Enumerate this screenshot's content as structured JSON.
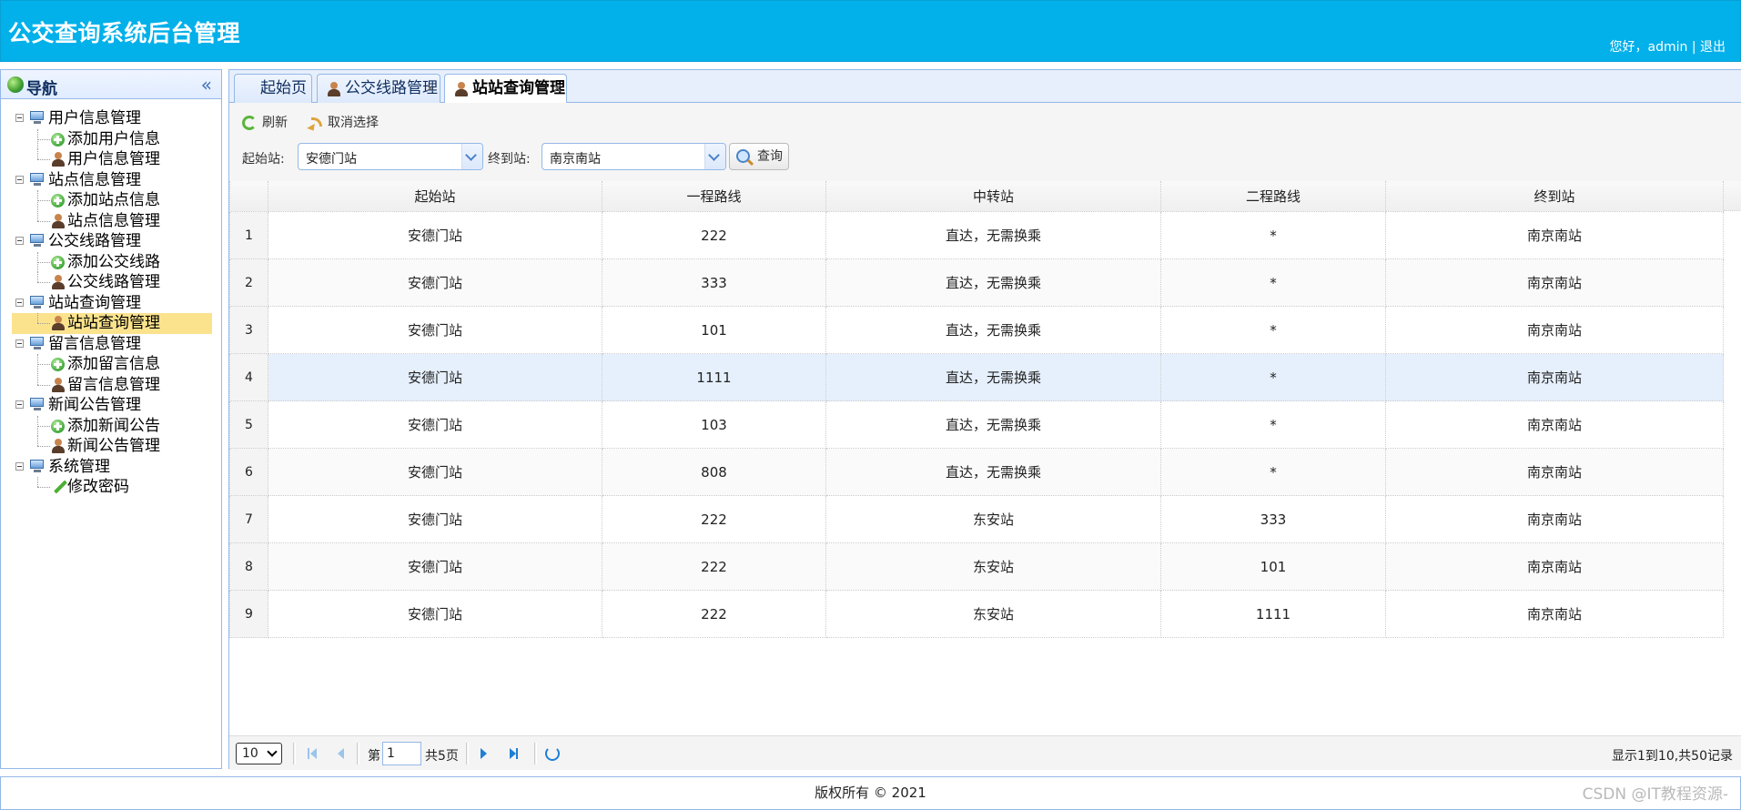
{
  "header": {
    "title": "公交查询系统后台管理",
    "greeting": "您好，admin",
    "divider": "|",
    "logout": "退出"
  },
  "nav": {
    "title": "导航",
    "groups": [
      {
        "label": "用户信息管理",
        "children": [
          {
            "label": "添加用户信息",
            "icon": "add-icon"
          },
          {
            "label": "用户信息管理",
            "icon": "user-icon"
          }
        ]
      },
      {
        "label": "站点信息管理",
        "children": [
          {
            "label": "添加站点信息",
            "icon": "add-icon"
          },
          {
            "label": "站点信息管理",
            "icon": "user-icon"
          }
        ]
      },
      {
        "label": "公交线路管理",
        "children": [
          {
            "label": "添加公交线路",
            "icon": "add-icon"
          },
          {
            "label": "公交线路管理",
            "icon": "user-icon"
          }
        ]
      },
      {
        "label": "站站查询管理",
        "children": [
          {
            "label": "站站查询管理",
            "icon": "user-icon",
            "selected": true
          }
        ]
      },
      {
        "label": "留言信息管理",
        "children": [
          {
            "label": "添加留言信息",
            "icon": "add-icon"
          },
          {
            "label": "留言信息管理",
            "icon": "user-icon"
          }
        ]
      },
      {
        "label": "新闻公告管理",
        "children": [
          {
            "label": "添加新闻公告",
            "icon": "add-icon"
          },
          {
            "label": "新闻公告管理",
            "icon": "user-icon"
          }
        ]
      },
      {
        "label": "系统管理",
        "children": [
          {
            "label": "修改密码",
            "icon": "pencil-icon"
          }
        ]
      }
    ]
  },
  "tabs": [
    {
      "label": "起始页",
      "closable": false,
      "active": false
    },
    {
      "label": "公交线路管理",
      "closable": true,
      "active": false
    },
    {
      "label": "站站查询管理",
      "closable": true,
      "active": true
    }
  ],
  "toolbar": {
    "refresh_label": "刷新",
    "cancel_label": "取消选择",
    "start_label": "起始站:",
    "start_value": "安德门站",
    "end_label": "终到站:",
    "end_value": "南京南站",
    "search_label": "查询"
  },
  "grid": {
    "columns": [
      "起始站",
      "一程路线",
      "中转站",
      "二程路线",
      "终到站"
    ],
    "rows": [
      [
        "1",
        "安德门站",
        "222",
        "直达，无需换乘",
        "*",
        "南京南站"
      ],
      [
        "2",
        "安德门站",
        "333",
        "直达，无需换乘",
        "*",
        "南京南站"
      ],
      [
        "3",
        "安德门站",
        "101",
        "直达，无需换乘",
        "*",
        "南京南站"
      ],
      [
        "4",
        "安德门站",
        "1111",
        "直达，无需换乘",
        "*",
        "南京南站"
      ],
      [
        "5",
        "安德门站",
        "103",
        "直达，无需换乘",
        "*",
        "南京南站"
      ],
      [
        "6",
        "安德门站",
        "808",
        "直达，无需换乘",
        "*",
        "南京南站"
      ],
      [
        "7",
        "安德门站",
        "222",
        "东安站",
        "333",
        "南京南站"
      ],
      [
        "8",
        "安德门站",
        "222",
        "东安站",
        "101",
        "南京南站"
      ],
      [
        "9",
        "安德门站",
        "222",
        "东安站",
        "1111",
        "南京南站"
      ]
    ]
  },
  "pager": {
    "page_size": "10",
    "page_prefix": "第",
    "page_value": "1",
    "page_total": "共5页",
    "info": "显示1到10,共50记录"
  },
  "footer": {
    "copyright": "版权所有 © 2021"
  },
  "watermark": "CSDN @IT教程资源-",
  "colors": {
    "header_bg": "#02b0ea",
    "selected_bg": "#fbe38e",
    "border": "#95b8e7",
    "hover_row": "#e6f0fd"
  }
}
